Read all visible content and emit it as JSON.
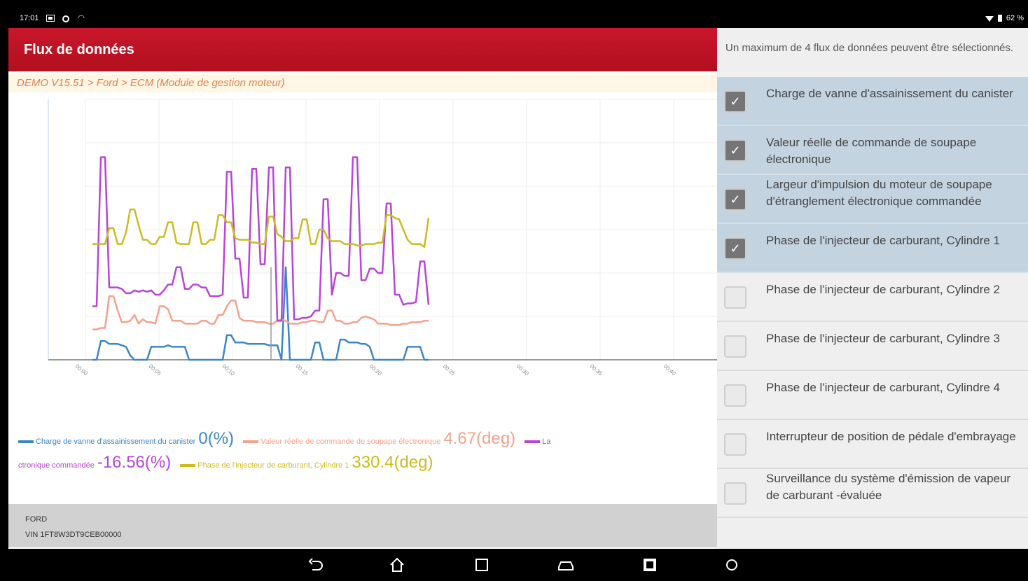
{
  "status_bar": {
    "time": "17:01",
    "battery": "62 %"
  },
  "app_title": "Flux de données",
  "breadcrumb": "DEMO V15.51 > Ford > ECM (Module de gestion moteur)",
  "chart_data": {
    "type": "line",
    "x_tick_labels": [
      "00:00",
      "00:05",
      "00:10",
      "00:15",
      "00:20",
      "00:25",
      "00:30",
      "00:35",
      "00:40"
    ],
    "x": [
      0,
      1,
      2,
      3,
      4,
      5,
      6,
      7,
      8,
      9,
      10,
      11,
      12,
      13,
      14,
      15,
      16,
      17,
      18,
      19,
      20,
      21,
      22,
      23,
      24,
      25,
      26,
      27,
      28,
      29,
      30,
      31,
      32,
      33,
      34,
      35,
      36,
      37,
      38,
      39,
      40,
      41,
      42,
      43,
      44,
      45,
      46,
      47,
      48,
      49,
      50,
      51,
      52,
      53,
      54,
      55,
      56,
      57,
      58,
      59,
      60,
      61,
      62,
      63,
      64,
      65,
      66,
      67,
      68,
      69,
      70,
      71,
      72,
      73,
      74,
      75,
      76,
      77,
      78,
      79,
      80
    ],
    "ylim": [
      0,
      180
    ],
    "series": [
      {
        "name": "Charge de vanne d'assainissement du canister",
        "color": "#3d85c6",
        "values": [
          0,
          0,
          13,
          13,
          11,
          11,
          11,
          10,
          9,
          3,
          0,
          0,
          0,
          0,
          9,
          9,
          9,
          9,
          10,
          9,
          9,
          9,
          9,
          0,
          0,
          0,
          0,
          0,
          0,
          0,
          0,
          0,
          17,
          17,
          12,
          12,
          12,
          11,
          11,
          11,
          11,
          11,
          10,
          10,
          10,
          0,
          64,
          0,
          0,
          0,
          0,
          0,
          0,
          12,
          12,
          0,
          0,
          0,
          0,
          14,
          14,
          12,
          12,
          12,
          11,
          11,
          9,
          0,
          0,
          0,
          0,
          0,
          0,
          0,
          0,
          9,
          9,
          9,
          9,
          0,
          0
        ]
      },
      {
        "name": "Valeur réelle de commande de soupape électronique",
        "color": "#f4a28c",
        "values": [
          21,
          21,
          22,
          22,
          44,
          44,
          34,
          26,
          26,
          27,
          31,
          25,
          28,
          26,
          26,
          25,
          37,
          37,
          35,
          27,
          27,
          27,
          25,
          25,
          25,
          25,
          27,
          27,
          25,
          25,
          31,
          31,
          37,
          41,
          41,
          29,
          27,
          27,
          27,
          26,
          26,
          26,
          25,
          25,
          27,
          28,
          27,
          25,
          25,
          25,
          26,
          26,
          27,
          27,
          26,
          26,
          34,
          34,
          27,
          27,
          25,
          25,
          26,
          26,
          29,
          30,
          29,
          28,
          25,
          25,
          25,
          24,
          24,
          24,
          25,
          25,
          26,
          26,
          26,
          27,
          27
        ]
      },
      {
        "name": "Largeur d'impulsion du moteur de soupape d'étranglement électronique commandée",
        "color": "#b845d6",
        "values": [
          37,
          37,
          140,
          140,
          50,
          50,
          50,
          49,
          46,
          46,
          48,
          47,
          48,
          47,
          48,
          45,
          45,
          48,
          52,
          52,
          64,
          64,
          49,
          49,
          52,
          52,
          50,
          50,
          44,
          44,
          44,
          45,
          130,
          130,
          70,
          70,
          43,
          43,
          132,
          132,
          66,
          66,
          133,
          133,
          27,
          27,
          133,
          133,
          28,
          28,
          29,
          29,
          30,
          34,
          34,
          111,
          111,
          45,
          60,
          60,
          58,
          58,
          140,
          140,
          55,
          55,
          63,
          63,
          60,
          60,
          108,
          108,
          45,
          45,
          38,
          39,
          39,
          40,
          68,
          68,
          38
        ]
      },
      {
        "name": "Phase de l'injecteur de carburant, Cylindre 1",
        "color": "#ccbb22",
        "values": [
          80,
          80,
          80,
          80,
          91,
          91,
          80,
          80,
          88,
          104,
          104,
          93,
          83,
          83,
          80,
          80,
          85,
          85,
          95,
          95,
          81,
          80,
          80,
          80,
          95,
          95,
          80,
          80,
          83,
          83,
          100,
          100,
          95,
          95,
          84,
          83,
          83,
          83,
          81,
          81,
          80,
          80,
          99,
          99,
          87,
          85,
          82,
          82,
          84,
          84,
          97,
          97,
          80,
          80,
          90,
          90,
          84,
          82,
          82,
          82,
          80,
          80,
          80,
          79,
          79,
          80,
          80,
          80,
          81,
          81,
          100,
          100,
          98,
          97,
          90,
          83,
          80,
          80,
          80,
          78,
          98
        ]
      }
    ]
  },
  "legend": [
    {
      "label": "Charge de vanne d'assainissement du canister",
      "value": "0(%)",
      "color": "#3d85c6"
    },
    {
      "label": "Valeur réelle de commande de soupape électronique",
      "value": "4.67(deg)",
      "color": "#f4a28c"
    },
    {
      "label": "Largeur d'impulsion du moteur de soupape d'étranglement électronique commandée",
      "value": "-16.56(%)",
      "color": "#b845d6"
    },
    {
      "label": "Phase de l'injecteur de carburant, Cylindre 1",
      "value": "330.4(deg)",
      "color": "#ccbb22"
    }
  ],
  "legend_row1_label3": "La",
  "legend_row2_label3": "ctronique commandée",
  "footer": {
    "make": "FORD",
    "vin": "VIN 1FT8W3DT9CEB00000"
  },
  "panel": {
    "header": "Un maximum de 4 flux de données peuvent être sélectionnés.",
    "options": [
      {
        "label": "Charge de vanne d'assainissement du canister",
        "checked": true
      },
      {
        "label": "Valeur réelle de commande de soupape électronique",
        "checked": true
      },
      {
        "label": "Largeur d'impulsion du moteur de soupape d'étranglement électronique commandée",
        "checked": true
      },
      {
        "label": "Phase de l'injecteur de carburant, Cylindre 1",
        "checked": true
      },
      {
        "label": "Phase de l'injecteur de carburant, Cylindre 2",
        "checked": false
      },
      {
        "label": "Phase de l'injecteur de carburant, Cylindre 3",
        "checked": false
      },
      {
        "label": "Phase de l'injecteur de carburant, Cylindre 4",
        "checked": false
      },
      {
        "label": "Interrupteur de position de pédale d'embrayage",
        "checked": false
      },
      {
        "label": "Surveillance du système d'émission de vapeur de carburant -évaluée",
        "checked": false
      }
    ]
  },
  "checkmark": "✓",
  "nav_icons": [
    "back-icon",
    "home-icon",
    "recent-apps-icon",
    "car-icon",
    "screenshot-icon",
    "settings-icon"
  ]
}
